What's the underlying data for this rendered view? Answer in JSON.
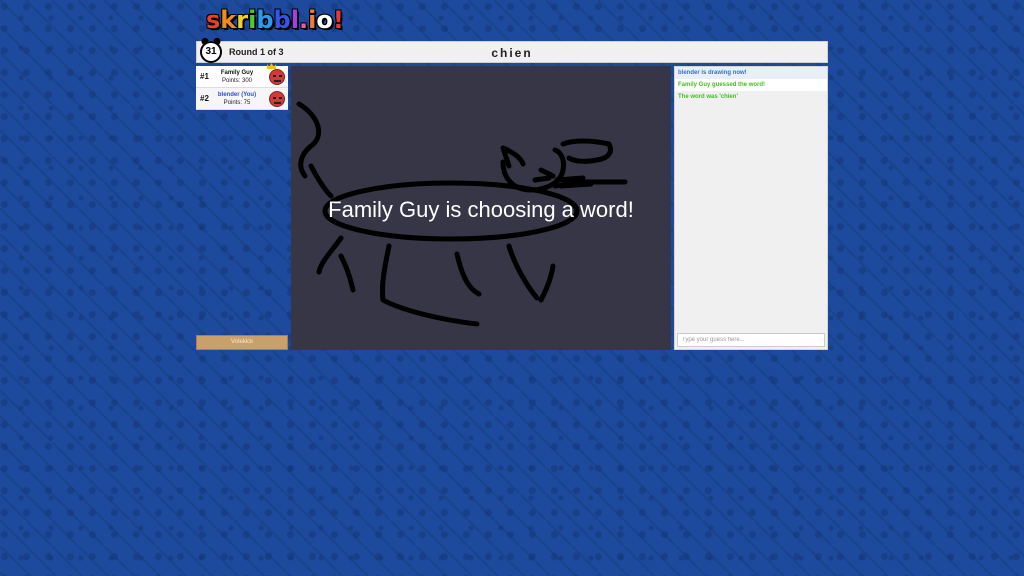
{
  "logo": {
    "letters": [
      "s",
      "k",
      "r",
      "i",
      "b",
      "b",
      "l",
      ".",
      "i",
      "o",
      "!"
    ],
    "colors": [
      "#e8402b",
      "#f38a1c",
      "#f5d01e",
      "#4fca2c",
      "#2b9bf0",
      "#3355e8",
      "#a63fe0",
      "#e85a9c",
      "#ef7a3b",
      "#ffffff",
      "#e83838"
    ]
  },
  "header": {
    "timer": "31",
    "round_text": "Round 1 of 3",
    "word": "chien"
  },
  "players": [
    {
      "rank": "#1",
      "name": "Family Guy",
      "points": "Points: 300",
      "is_you": false,
      "crown": true
    },
    {
      "rank": "#2",
      "name": "blender (You)",
      "points": "Points: 75",
      "is_you": true,
      "crown": false
    }
  ],
  "votekick_label": "Votekick",
  "canvas": {
    "overlay_text": "Family Guy is choosing a word!"
  },
  "chat": {
    "messages": [
      {
        "text": "blender is drawing now!",
        "color": "blue"
      },
      {
        "text": "Family Guy guessed the word!",
        "color": "green"
      },
      {
        "text": "The word was 'chien'",
        "color": "green"
      }
    ],
    "input_placeholder": "Type your guess here..."
  }
}
